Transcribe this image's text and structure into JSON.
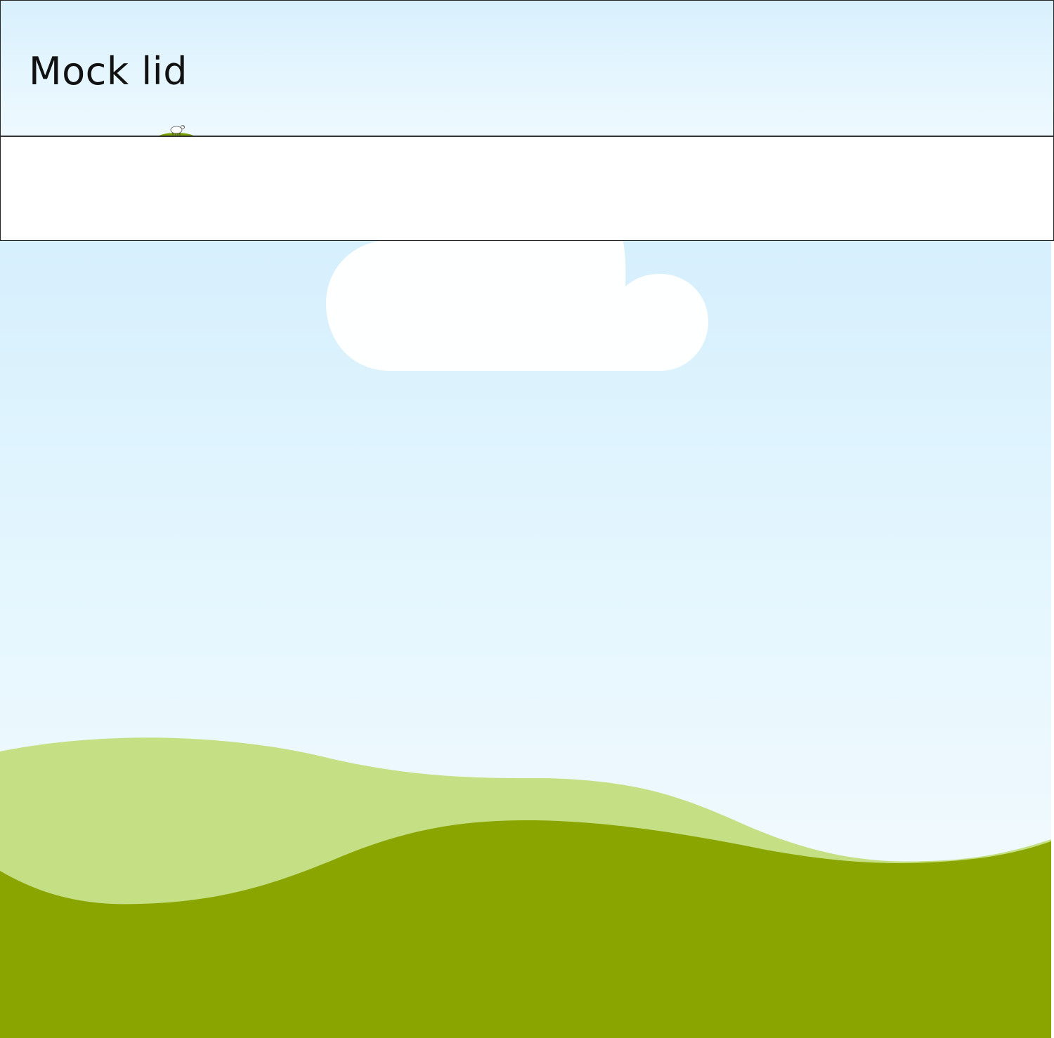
{
  "lid": {
    "title": "Mock lid"
  },
  "scene": {
    "sky_top_color": "#cdeafb",
    "sky_bottom_color": "#f2fbff",
    "cloud_color": "#ffffff",
    "back_hill_color": "#c5df84",
    "front_hill_color": "#8aa500",
    "icons": [
      "cloud-icon",
      "sheep-icon"
    ]
  },
  "panel": {
    "background": "#ffffff"
  }
}
